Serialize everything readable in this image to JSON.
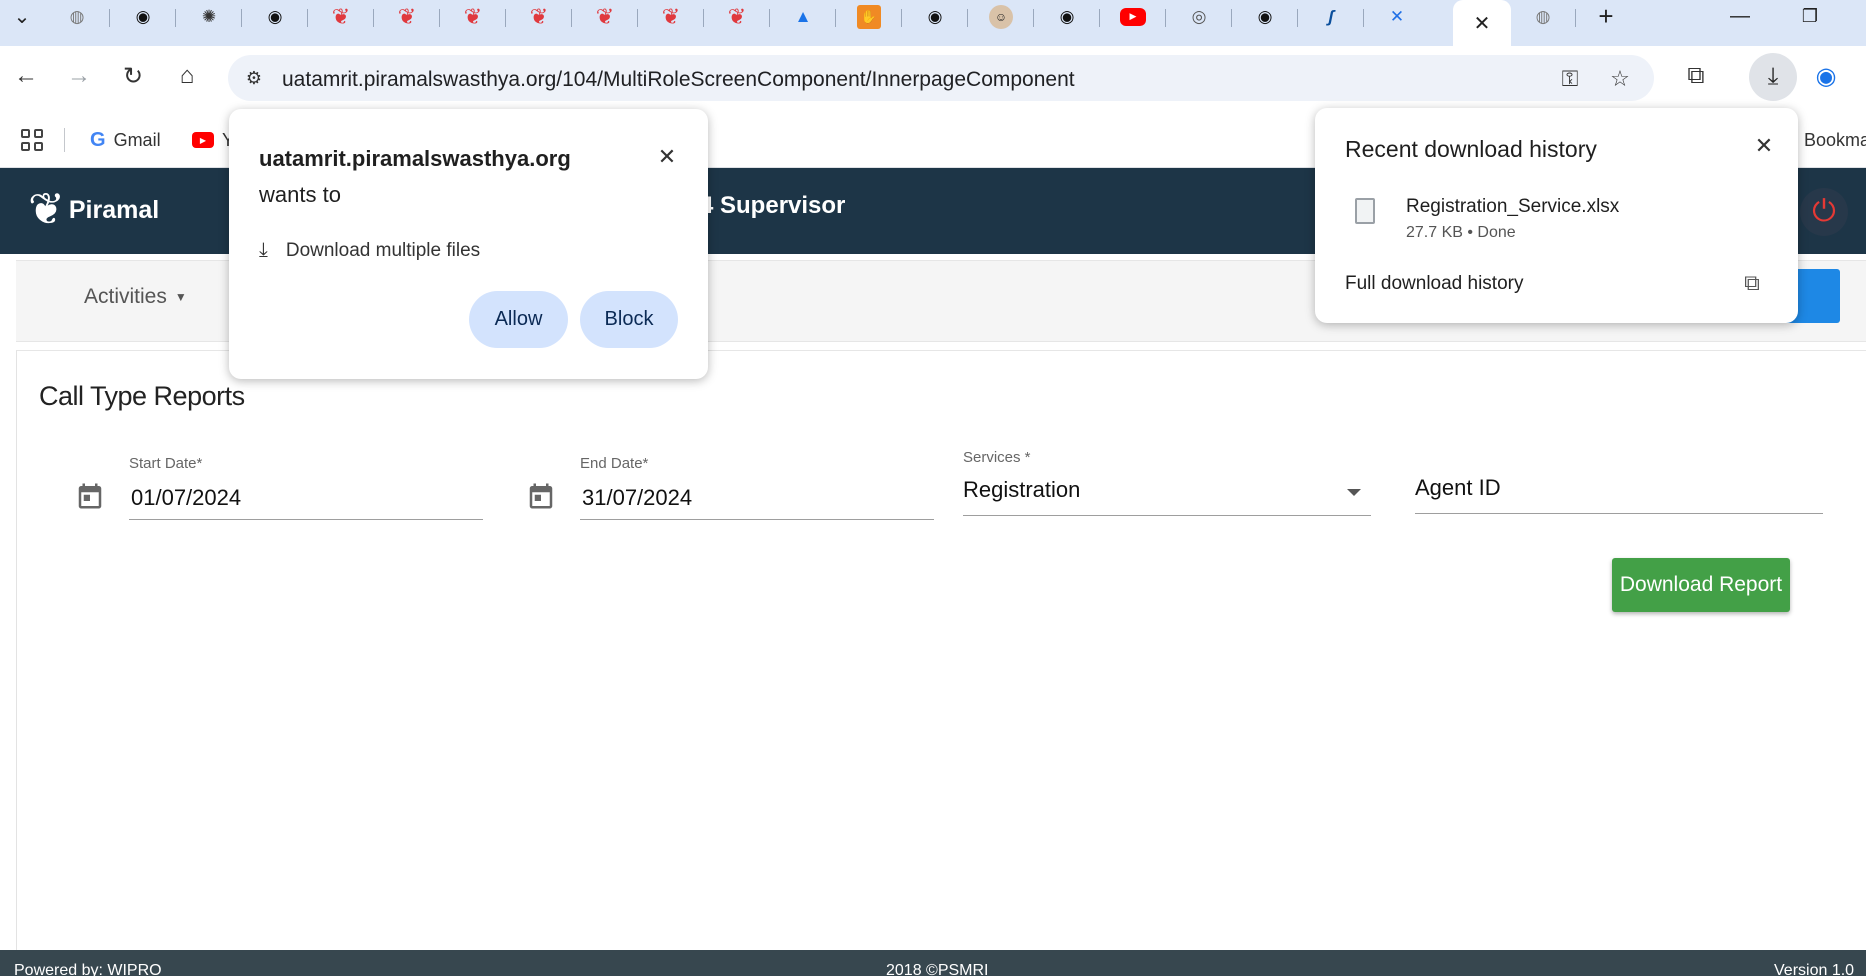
{
  "browser": {
    "tabs": [
      {
        "icon": "globe-icon"
      },
      {
        "icon": "github-icon"
      },
      {
        "icon": "openai-icon"
      },
      {
        "icon": "github-icon"
      },
      {
        "icon": "piramal-icon"
      },
      {
        "icon": "piramal-icon"
      },
      {
        "icon": "piramal-icon"
      },
      {
        "icon": "piramal-icon"
      },
      {
        "icon": "piramal-icon"
      },
      {
        "icon": "piramal-icon"
      },
      {
        "icon": "piramal-icon"
      },
      {
        "icon": "azure-icon"
      },
      {
        "icon": "orange-app-icon"
      },
      {
        "icon": "github-icon"
      },
      {
        "icon": "avatar-icon"
      },
      {
        "icon": "github-icon"
      },
      {
        "icon": "youtube-icon"
      },
      {
        "icon": "chrome-icon"
      },
      {
        "icon": "github-icon"
      },
      {
        "icon": "italic-app-icon"
      },
      {
        "icon": "confluence-icon"
      }
    ],
    "url": "uatamrit.piramalswasthya.org/104/MultiRoleScreenComponent/InnerpageComponent",
    "bookmarks": {
      "gmail": "Gmail",
      "youtube_partial": "Y",
      "bookmarks_partial": "Bookma"
    }
  },
  "app": {
    "logo_text": "Piramal",
    "title_partial": "4 Supervisor",
    "menu": {
      "activities": "Activities"
    },
    "page_title": "Call Type Reports",
    "form": {
      "start_date_label": "Start Date*",
      "start_date_value": "01/07/2024",
      "end_date_label": "End Date*",
      "end_date_value": "31/07/2024",
      "services_label": "Services *",
      "services_value": "Registration",
      "agent_id_placeholder": "Agent ID"
    },
    "download_button": "Download Report",
    "footer": {
      "left": "Powered by: WIPRO",
      "center": "2018 ©PSMRI",
      "right": "Version 1.0"
    }
  },
  "permission_popup": {
    "site": "uatamrit.piramalswasthya.org",
    "wants_to": "wants to",
    "request": "Download multiple files",
    "allow": "Allow",
    "block": "Block"
  },
  "download_popup": {
    "title": "Recent download history",
    "file_name": "Registration_Service.xlsx",
    "file_meta": "27.7 KB • Done",
    "full_history": "Full download history"
  },
  "colors": {
    "header_bg": "#1d3547",
    "download_button_bg": "#43a047",
    "accent_blue": "#1e88e5",
    "pill_bg": "#d3e3fd",
    "power_red": "#e53935"
  }
}
